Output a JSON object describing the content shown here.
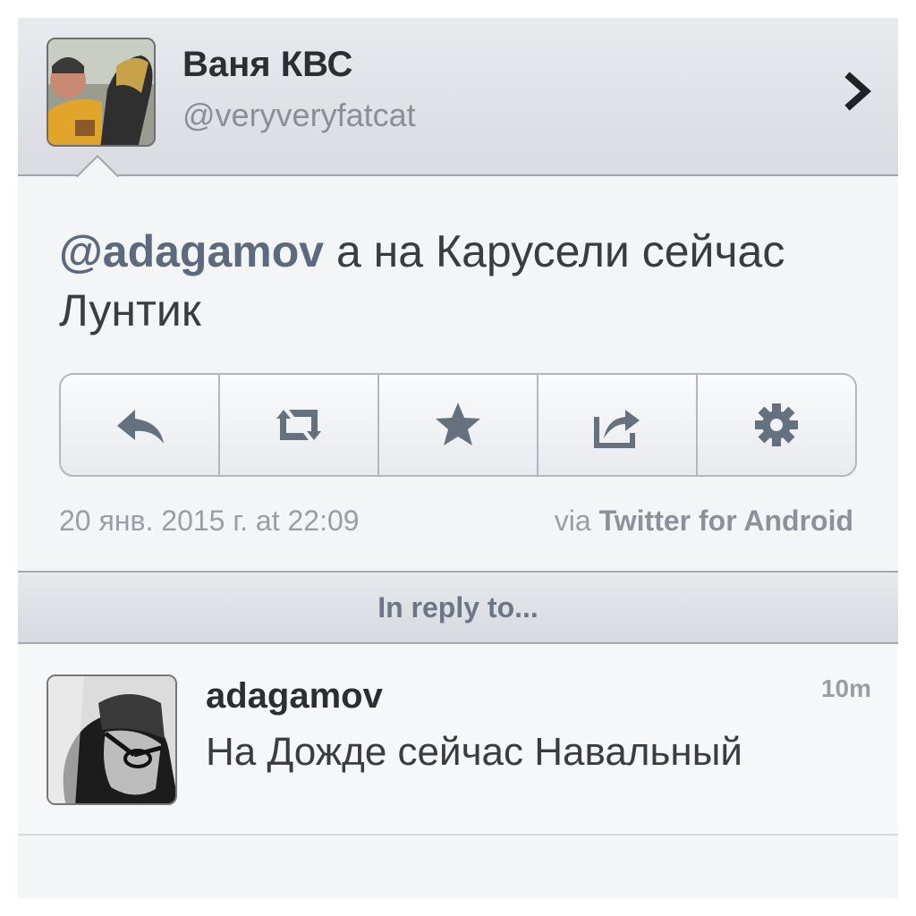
{
  "profile": {
    "display_name": "Ваня КВС",
    "handle": "@veryveryfatcat"
  },
  "tweet": {
    "mention": "@adagamov",
    "text": " а на Карусели сейчас Лунтик",
    "timestamp": "20 янв. 2015 г. at 22:09",
    "via_prefix": "via ",
    "client": "Twitter for Android"
  },
  "actions": [
    {
      "name": "reply",
      "icon": "reply-icon"
    },
    {
      "name": "retweet",
      "icon": "retweet-icon"
    },
    {
      "name": "favorite",
      "icon": "star-icon"
    },
    {
      "name": "share",
      "icon": "share-icon"
    },
    {
      "name": "more",
      "icon": "gear-icon"
    }
  ],
  "reply_section": {
    "label": "In reply to..."
  },
  "reply_tweet": {
    "author": "adagamov",
    "time": "10m",
    "text": "На Дожде сейчас Навальный"
  },
  "colors": {
    "mention": "#5c6a7e",
    "icon": "#66717f",
    "header_bg": "#dfe1e5"
  }
}
